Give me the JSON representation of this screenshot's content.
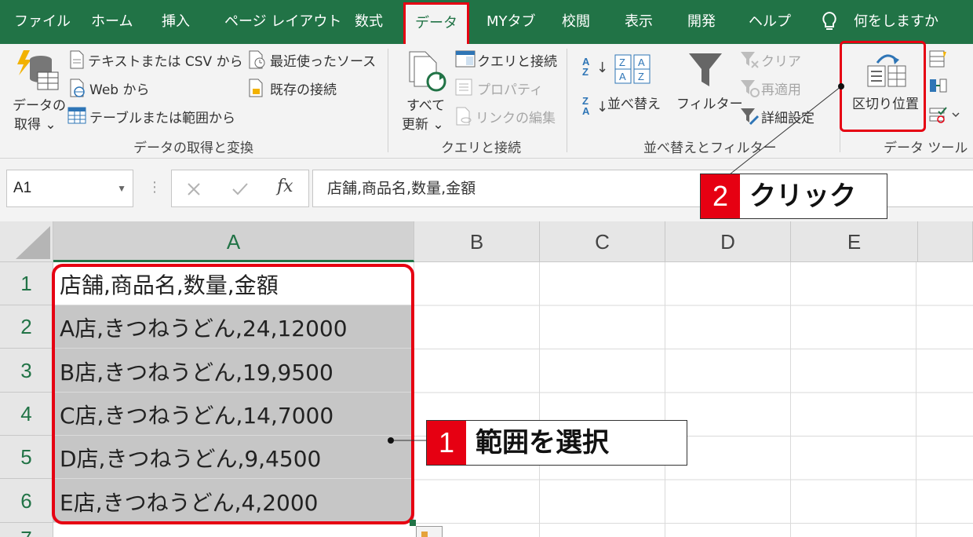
{
  "tabs": [
    "ファイル",
    "ホーム",
    "挿入",
    "ページ レイアウト",
    "数式",
    "データ",
    "MYタブ",
    "校閲",
    "表示",
    "開発",
    "ヘルプ"
  ],
  "tell_me": "何をしますか",
  "ribbon": {
    "get_data": {
      "big_label_1": "データの",
      "big_label_2": "取得 ⌄",
      "text_csv": "テキストまたは CSV から",
      "web": "Web から",
      "table_range": "テーブルまたは範囲から",
      "recent_sources": "最近使ったソース",
      "existing_connections": "既存の接続",
      "group_label": "データの取得と変換"
    },
    "queries": {
      "refresh_1": "すべて",
      "refresh_2": "更新 ⌄",
      "queries_connections": "クエリと接続",
      "properties": "プロパティ",
      "edit_links": "リンクの編集",
      "group_label": "クエリと接続"
    },
    "sort_filter": {
      "sort": "並べ替え",
      "filter": "フィルター",
      "clear": "クリア",
      "reapply": "再適用",
      "advanced": "詳細設定",
      "group_label": "並べ替えとフィルター"
    },
    "data_tools": {
      "text_to_columns": "区切り位置",
      "group_label": "データ ツール"
    }
  },
  "formula_bar": {
    "name_box": "A1",
    "fx": "fx",
    "formula": "店舗,商品名,数量,金額"
  },
  "grid": {
    "columns": [
      "A",
      "B",
      "C",
      "D",
      "E"
    ],
    "rows": [
      "1",
      "2",
      "3",
      "4",
      "5",
      "6",
      "7"
    ],
    "cells": [
      "店舗,商品名,数量,金額",
      "A店,きつねうどん,24,12000",
      "B店,きつねうどん,19,9500",
      "C店,きつねうどん,14,7000",
      "D店,きつねうどん,9,4500",
      "E店,きつねうどん,4,2000"
    ]
  },
  "callouts": {
    "step1_num": "1",
    "step1_text": "範囲を選択",
    "step2_num": "2",
    "step2_text": "クリック"
  },
  "colors": {
    "excel_green": "#217346",
    "highlight_red": "#e60012",
    "selection_gray": "#c6c6c6"
  }
}
